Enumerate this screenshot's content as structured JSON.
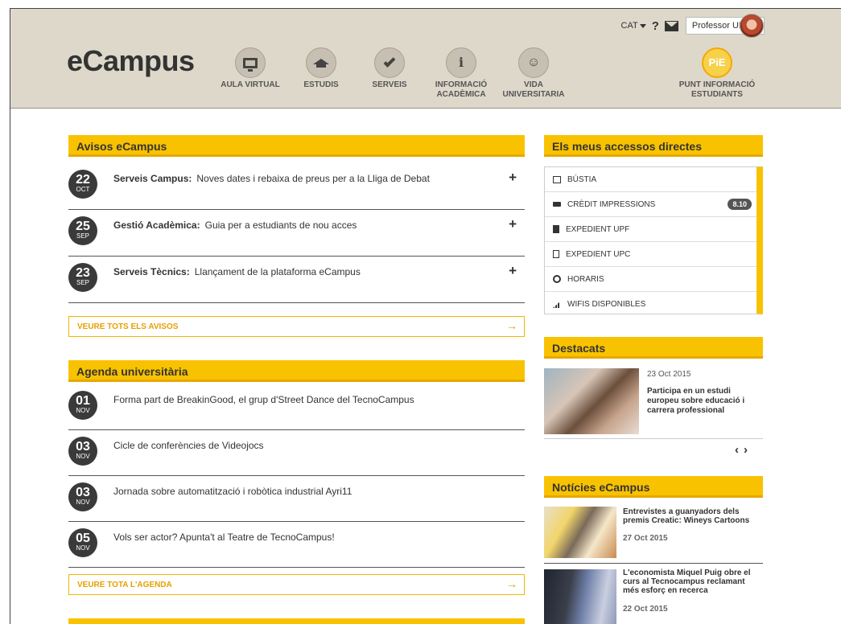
{
  "header": {
    "logo": "eCampus",
    "language": "CAT",
    "help": "?",
    "user_menu_label": "Professor UPF",
    "nav": [
      {
        "label_line1": "AULA VIRTUAL",
        "label_line2": "",
        "icon": "monitor-icon"
      },
      {
        "label_line1": "ESTUDIS",
        "label_line2": "",
        "icon": "graduation-cap-icon"
      },
      {
        "label_line1": "SERVEIS",
        "label_line2": "",
        "icon": "check-icon"
      },
      {
        "label_line1": "INFORMACIÓ",
        "label_line2": "ACADÈMICA",
        "icon": "info-icon"
      },
      {
        "label_line1": "VIDA",
        "label_line2": "UNIVERSITARIA",
        "icon": "person-icon"
      },
      {
        "label_line1": "PUNT INFORMACIÓ",
        "label_line2": "ESTUDIANTS",
        "icon": "pie-icon",
        "icon_text": "PiE"
      }
    ]
  },
  "avisos": {
    "title": "Avisos eCampus",
    "items": [
      {
        "day": "22",
        "month": "OCT",
        "category": "Serveis Campus:",
        "text": "Noves dates i rebaixa de preus per a la Lliga de Debat"
      },
      {
        "day": "25",
        "month": "SEP",
        "category": "Gestió Acadèmica:",
        "text": "Guia per a estudiants de nou acces"
      },
      {
        "day": "23",
        "month": "SEP",
        "category": "Serveis Tècnics:",
        "text": "Llançament de la plataforma eCampus"
      }
    ],
    "see_all": "VEURE TOTS ELS AVISOS"
  },
  "agenda": {
    "title": "Agenda universitària",
    "items": [
      {
        "day": "01",
        "month": "NOV",
        "text": "Forma part de BreakinGood, el grup d'Street Dance del TecnoCampus"
      },
      {
        "day": "03",
        "month": "NOV",
        "text": "Cicle de conferències de Videojocs"
      },
      {
        "day": "03",
        "month": "NOV",
        "text": "Jornada sobre automatització i robòtica industrial Ayri11"
      },
      {
        "day": "05",
        "month": "NOV",
        "text": "Vols ser actor? Apunta't al Teatre de TecnoCampus!"
      }
    ],
    "see_all": "VEURE TOTA L'AGENDA"
  },
  "accessos": {
    "title": "Els meus accessos directes",
    "items": [
      {
        "label": "BÚSTIA",
        "icon": "envelope-icon"
      },
      {
        "label": "CRÈDIT IMPRESSIONS",
        "icon": "printer-icon",
        "badge": "8.10"
      },
      {
        "label": "EXPEDIENT UPF",
        "icon": "file-icon"
      },
      {
        "label": "EXPEDIENT UPC",
        "icon": "file-outline-icon"
      },
      {
        "label": "HORARIS",
        "icon": "clock-icon"
      },
      {
        "label": "WIFIS DISPONIBLES",
        "icon": "signal-bars-icon"
      }
    ]
  },
  "destacats": {
    "title": "Destacats",
    "date": "23 Oct 2015",
    "headline": "Participa en un estudi europeu sobre educació i carrera professional"
  },
  "noticies": {
    "title": "Notícies eCampus",
    "items": [
      {
        "headline": "Entrevistes a guanyadors dels premis Creatic: Wineys Cartoons",
        "date": "27 Oct 2015"
      },
      {
        "headline": "L'economista Miquel Puig obre el curs al Tecnocampus reclamant més esforç en recerca",
        "date": "22 Oct 2015"
      }
    ]
  },
  "colors": {
    "accent": "#f9c200",
    "header_bg": "#ded8cb",
    "badge_dark": "#3a3a3a"
  }
}
